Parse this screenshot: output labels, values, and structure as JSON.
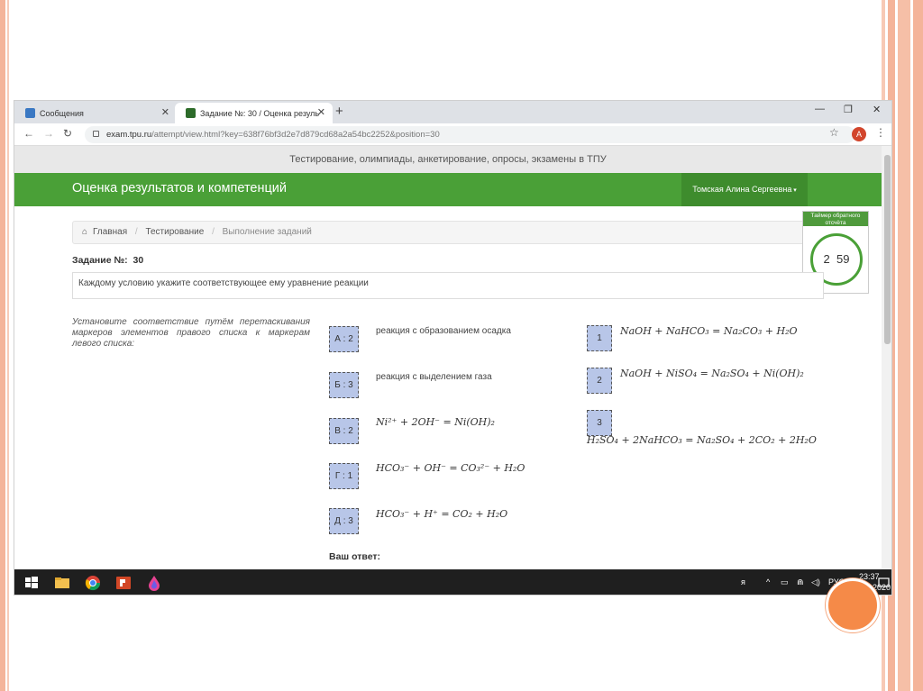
{
  "colors": {
    "green": "#4aa037",
    "accent": "#f58a48",
    "marker_fill": "#b8c6e8"
  },
  "browser": {
    "tabs": [
      {
        "label": "Сообщения",
        "icon": "message-icon"
      },
      {
        "label": "Задание №: 30 / Оценка резуль",
        "icon": "tpu-logo-icon"
      }
    ],
    "url_host": "exam.tpu.ru",
    "url_path": "/attempt/view.html?key=638f76bf3d2e7d879cd68a2a54bc2252&position=30",
    "profile_letter": "A"
  },
  "site": {
    "top_text": "Тестирование, олимпиады, анкетирование, опросы, экзамены в ТПУ",
    "brand": "Оценка результатов и компетенций",
    "user": "Томская Алина Сергеевна"
  },
  "breadcrumb": {
    "home": "Главная",
    "testing": "Тестирование",
    "current": "Выполнение заданий"
  },
  "timer": {
    "title": "Таймер обратного отсчёта",
    "minutes": "2",
    "seconds": "59"
  },
  "task": {
    "label": "Задание №:",
    "number": "30",
    "question": "Каждому условию укажите соответствующее ему уравнение реакции",
    "instruction": "Установите соответствие путём перетаскивания маркеров элементов правого списка к маркерам левого списка:",
    "answer_label": "Ваш ответ:"
  },
  "left_items": [
    {
      "marker": "А : 2",
      "text": "реакция с образованием осадка"
    },
    {
      "marker": "Б : 3",
      "text": "реакция с выделением газа"
    },
    {
      "marker": "В : 2",
      "text": "Ni²⁺ + 2OH⁻ = Ni(OH)₂"
    },
    {
      "marker": "Г : 1",
      "text": "HCO₃⁻ + OH⁻ = CO₃²⁻ + H₂O"
    },
    {
      "marker": "Д : 3",
      "text": "HCO₃⁻ + H⁺ = CO₂ + H₂O"
    }
  ],
  "right_items": [
    {
      "marker": "1",
      "text": "NaOH + NaHCO₃ = Na₂CO₃ + H₂O"
    },
    {
      "marker": "2",
      "text": "NaOH + NiSO₄ = Na₂SO₄ + Ni(OH)₂"
    },
    {
      "marker": "3",
      "text": "H₂SO₄ + 2NaHCO₃ = Na₂SO₄ + 2CO₂ + 2H₂O"
    }
  ],
  "taskbar": {
    "lang": "РУС",
    "time": "23:37",
    "date": "18.06.2020"
  }
}
